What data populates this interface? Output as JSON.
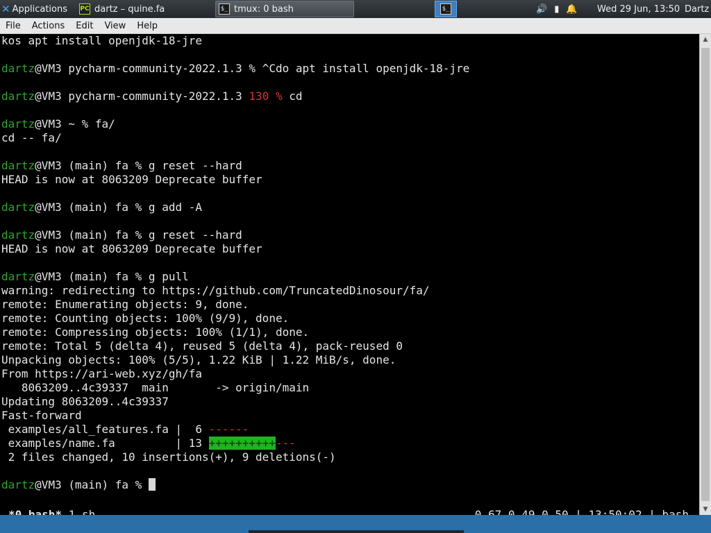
{
  "panel": {
    "apps_label": "Applications",
    "tasks": [
      {
        "label": "dartz – quine.fa",
        "icon": "pycharm-icon"
      },
      {
        "label": "tmux: 0 bash",
        "icon": "terminal-icon"
      }
    ],
    "clock": "Wed 29 Jun, 13:50",
    "user": "Dartz"
  },
  "menu": {
    "file": "File",
    "actions": "Actions",
    "edit": "Edit",
    "view": "View",
    "help": "Help"
  },
  "terminal": {
    "l0": "kos apt install openjdk-18-jre",
    "l2_user": "dartz",
    "l2_rest": "@VM3 pycharm-community-2022.1.3 % ^Cdo apt install openjdk-18-jre",
    "l4_user": "dartz",
    "l4_mid": "@VM3 pycharm-community-2022.1.3 ",
    "l4_code": "130 %",
    "l4_rest": " cd",
    "l6_user": "dartz",
    "l6_rest": "@VM3 ~ % fa/",
    "l7": "cd -- fa/",
    "l9_user": "dartz",
    "l9_rest": "@VM3 (main) fa % g reset --hard",
    "l10": "HEAD is now at 8063209 Deprecate buffer",
    "l12_user": "dartz",
    "l12_rest": "@VM3 (main) fa % g add -A",
    "l14_user": "dartz",
    "l14_rest": "@VM3 (main) fa % g reset --hard",
    "l15": "HEAD is now at 8063209 Deprecate buffer",
    "l17_user": "dartz",
    "l17_rest": "@VM3 (main) fa % g pull",
    "l18": "warning: redirecting to https://github.com/TruncatedDinosour/fa/",
    "l19": "remote: Enumerating objects: 9, done.",
    "l20": "remote: Counting objects: 100% (9/9), done.",
    "l21": "remote: Compressing objects: 100% (1/1), done.",
    "l22": "remote: Total 5 (delta 4), reused 5 (delta 4), pack-reused 0",
    "l23": "Unpacking objects: 100% (5/5), 1.22 KiB | 1.22 MiB/s, done.",
    "l24": "From https://ari-web.xyz/gh/fa",
    "l25": "   8063209..4c39337  main       -> origin/main",
    "l26": "Updating 8063209..4c39337",
    "l27": "Fast-forward",
    "l28_file": " examples/all_features.fa |  6 ",
    "l28_minus": "------",
    "l29_file": " examples/name.fa         | 13 ",
    "l29_plus": "++++++++++",
    "l29_minus": "---",
    "l30": " 2 files changed, 10 insertions(+), 9 deletions(-)",
    "l32_user": "dartz",
    "l32_rest": "@VM3 (main) fa % "
  },
  "status": {
    "window": "*0 bash*",
    "session_rest": " 1 sh",
    "right": "0.67 0.49 0.50 | 13:50:02 | bash"
  }
}
